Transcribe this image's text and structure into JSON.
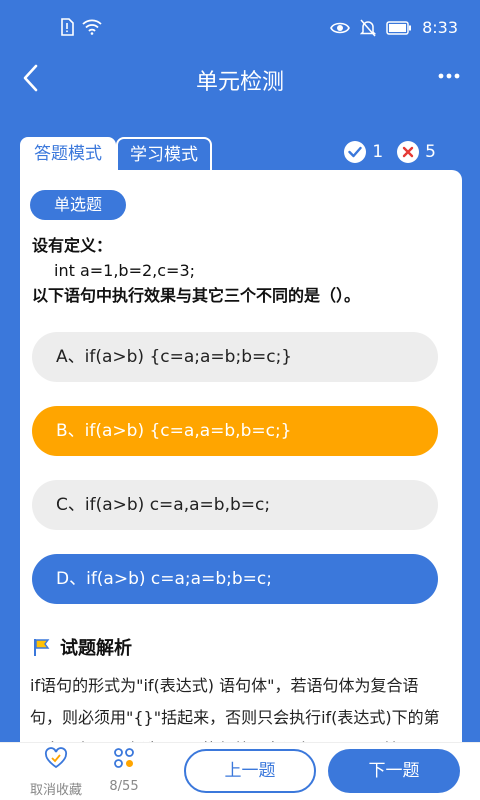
{
  "status_bar": {
    "time": "8:33"
  },
  "nav": {
    "title": "单元检测"
  },
  "tabs": [
    {
      "label": "答题模式"
    },
    {
      "label": "学习模式"
    }
  ],
  "stats": {
    "correct": "1",
    "wrong": "5"
  },
  "question": {
    "type": "单选题",
    "line1": "设有定义：",
    "line2": "int  a=1,b=2,c=3;",
    "line3": "以下语句中执行效果与其它三个不同的是（）。"
  },
  "options": [
    {
      "label": "A、if(a>b) {c=a;a=b;b=c;}"
    },
    {
      "label": "B、if(a>b) {c=a,a=b,b=c;}"
    },
    {
      "label": "C、if(a>b) c=a,a=b,b=c;"
    },
    {
      "label": "D、if(a>b) c=a;a=b;b=c;"
    }
  ],
  "analysis": {
    "title": "试题解析",
    "text": "if语句的形式为\"if(表达式) 语句体\"，若语句体为复合语句，则必须用\"{}\"括起来，否则只会执行if(表达式)下的第一条语句，只有选项D只执行第一条语句\"c=a;\"，其"
  },
  "bottom": {
    "fav_label": "取消收藏",
    "progress": "8/55",
    "prev": "上一题",
    "next": "下一题"
  },
  "colors": {
    "primary": "#3B78DB",
    "selected": "#FFA500",
    "wrong": "#E53935"
  }
}
